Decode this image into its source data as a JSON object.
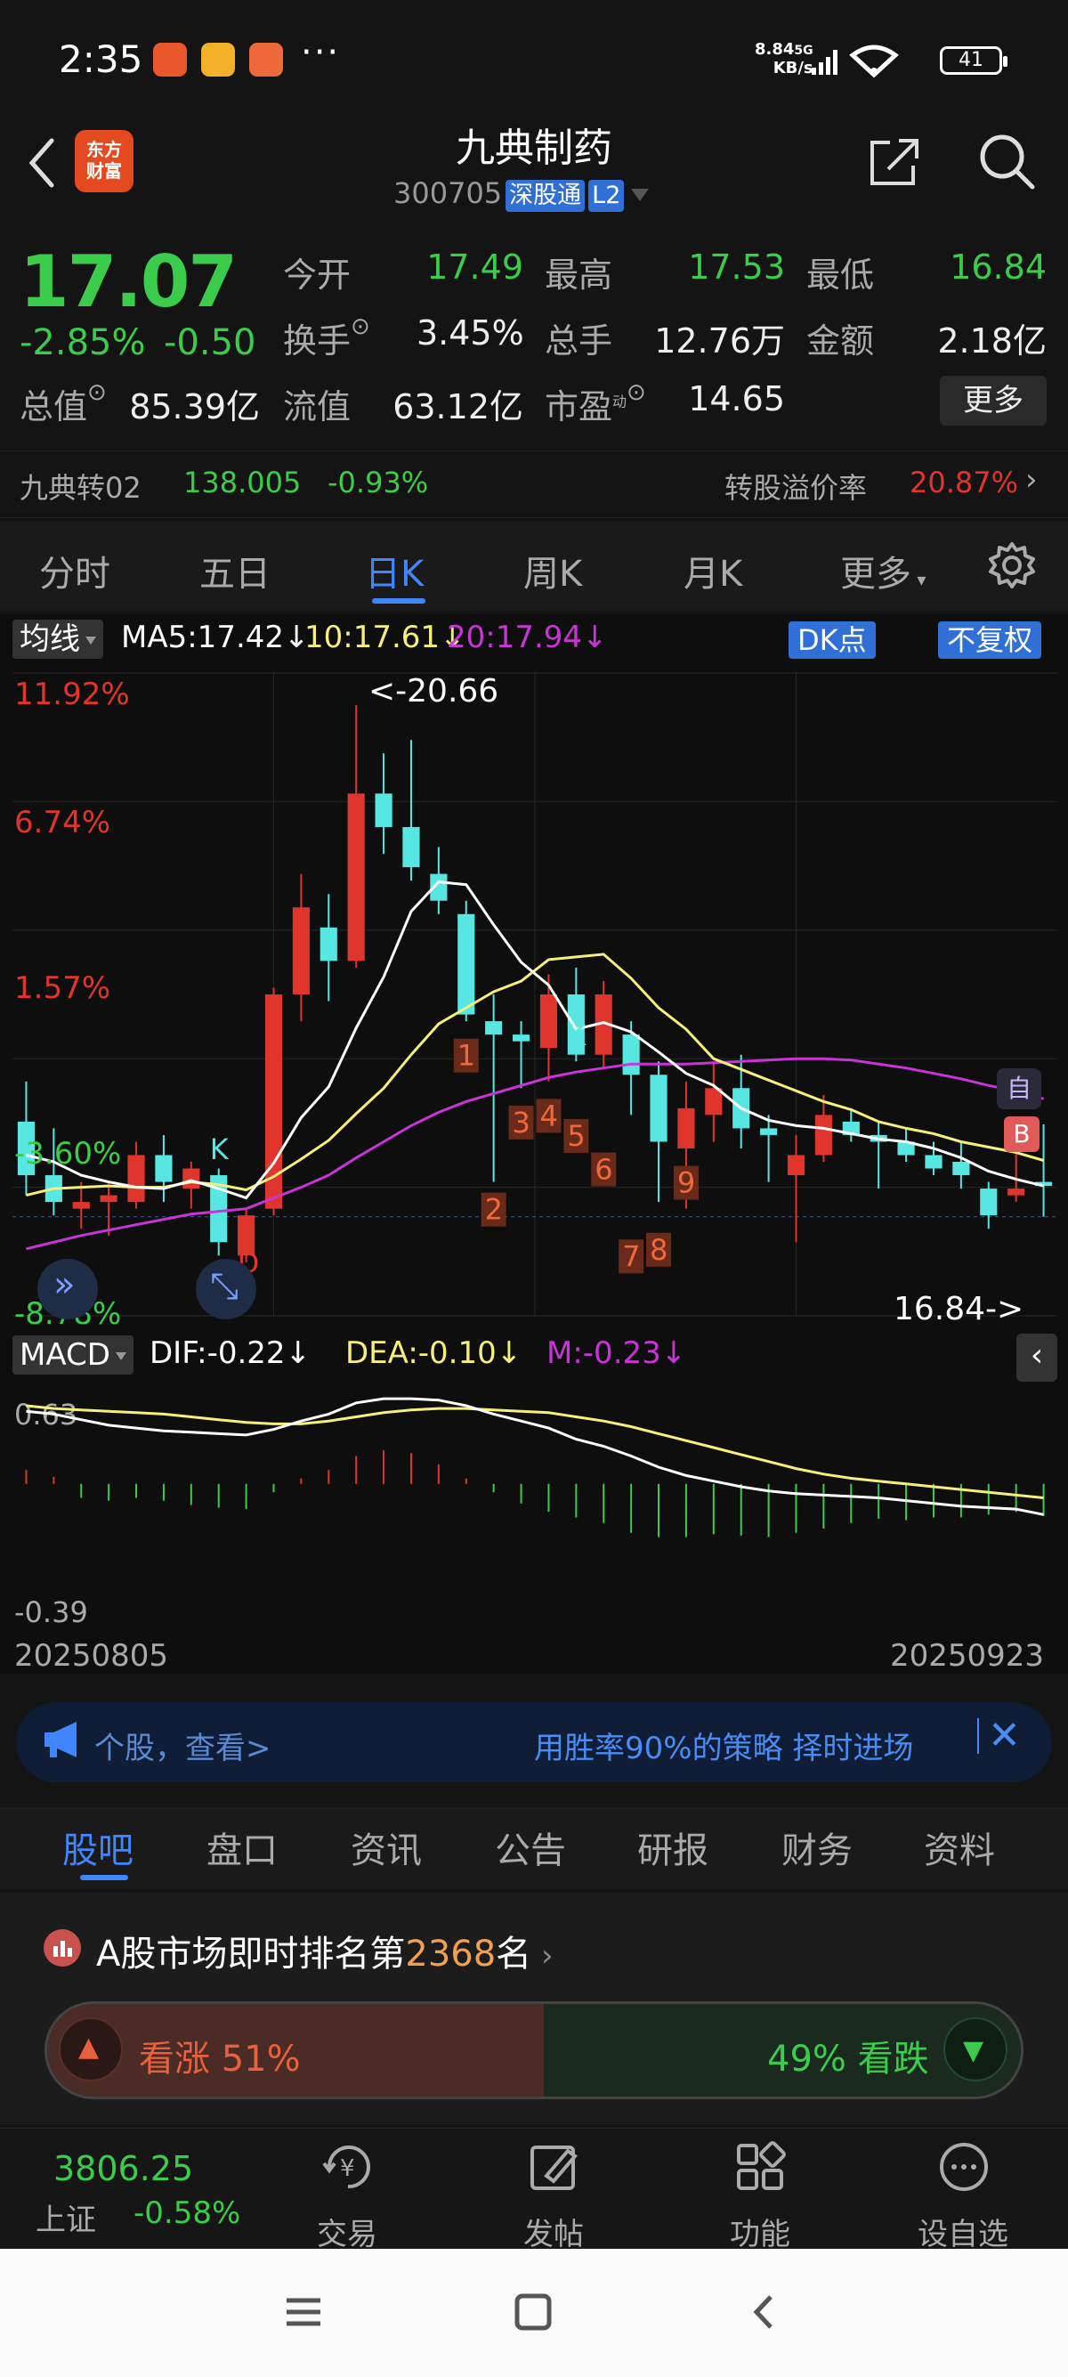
{
  "status_bar": {
    "time": "2:35",
    "more": "···",
    "net_speed_value": "8.84",
    "net_speed_unit": "KB/s",
    "network": "5G",
    "battery": "41"
  },
  "header": {
    "logo_line1": "东方",
    "logo_line2": "财富",
    "stock_name": "九典制药",
    "stock_code": "300705",
    "tag_connect": "深股通",
    "tag_level": "L2"
  },
  "quote": {
    "price": "17.07",
    "change_pct": "-2.85%",
    "change_abs": "-0.50",
    "labels": {
      "open": "今开",
      "high": "最高",
      "low": "最低",
      "turnover": "换手",
      "volume": "总手",
      "amount": "金额",
      "total_cap": "总值",
      "float_cap": "流值",
      "pe": "市盈",
      "pe_sup": "动"
    },
    "values": {
      "open": "17.49",
      "high": "17.53",
      "low": "16.84",
      "turnover": "3.45%",
      "volume": "12.76万",
      "amount": "2.18亿",
      "total_cap": "85.39亿",
      "float_cap": "63.12亿",
      "pe": "14.65"
    },
    "more_button": "更多"
  },
  "convertible": {
    "name": "九典转02",
    "price": "138.005",
    "change": "-0.93%",
    "premium_label": "转股溢价率",
    "premium_value": "20.87%"
  },
  "chart_tabs": [
    "分时",
    "五日",
    "日K",
    "周K",
    "月K",
    "更多"
  ],
  "chart_tabs_active": "日K",
  "chart_header": {
    "indicator_select": "均线",
    "ma5": "MA5:17.42",
    "ma10": "10:17.61",
    "ma20": "20:17.94",
    "dk_button": "DK点",
    "fuquan_button": "不复权"
  },
  "price_axis_labels": [
    "11.92%",
    "6.74%",
    "1.57%",
    "-3.60%",
    "-8.78%"
  ],
  "high_marker": "<-20.66",
  "low_marker": "16.84->",
  "signal_labels": [
    "K",
    "D",
    "1",
    "2",
    "3",
    "4",
    "5",
    "6",
    "7",
    "8",
    "9",
    "K"
  ],
  "badges": {
    "zi": "自",
    "b": "B"
  },
  "macd_header": {
    "indicator_select": "MACD",
    "dif": "DIF:-0.22",
    "dea": "DEA:-0.10",
    "m": "M:-0.23"
  },
  "macd_axis": [
    "0.63",
    "-0.39"
  ],
  "date_start": "20250805",
  "date_end": "20250923",
  "colors": {
    "up": "#e0352c",
    "down": "#58e6e3",
    "ma5": "#ffffff",
    "ma10": "#f6f07a",
    "ma20": "#c934d6",
    "accent": "#3f86ff",
    "green": "#3ccc4b"
  },
  "chart_data": {
    "type": "candlestick",
    "x_start": "20250805",
    "x_end": "20250923",
    "candles": [
      {
        "o": 17.55,
        "h": 17.85,
        "l": 17.0,
        "c": 17.15
      },
      {
        "o": 17.15,
        "h": 17.5,
        "l": 16.85,
        "c": 16.95
      },
      {
        "o": 16.9,
        "h": 17.1,
        "l": 16.75,
        "c": 16.95
      },
      {
        "o": 16.95,
        "h": 17.1,
        "l": 16.7,
        "c": 17.0
      },
      {
        "o": 16.95,
        "h": 17.4,
        "l": 16.9,
        "c": 17.3
      },
      {
        "o": 17.3,
        "h": 17.45,
        "l": 16.95,
        "c": 17.1
      },
      {
        "o": 17.05,
        "h": 17.25,
        "l": 16.9,
        "c": 17.2
      },
      {
        "o": 17.15,
        "h": 17.2,
        "l": 16.55,
        "c": 16.65
      },
      {
        "o": 16.55,
        "h": 16.9,
        "l": 16.5,
        "c": 16.85
      },
      {
        "o": 16.9,
        "h": 18.55,
        "l": 16.85,
        "c": 18.5
      },
      {
        "o": 18.5,
        "h": 19.4,
        "l": 18.3,
        "c": 19.15
      },
      {
        "o": 19.0,
        "h": 19.25,
        "l": 18.45,
        "c": 18.75
      },
      {
        "o": 18.75,
        "h": 20.66,
        "l": 18.7,
        "c": 20.0
      },
      {
        "o": 20.0,
        "h": 20.3,
        "l": 19.55,
        "c": 19.75
      },
      {
        "o": 19.75,
        "h": 20.4,
        "l": 19.35,
        "c": 19.45
      },
      {
        "o": 19.4,
        "h": 19.6,
        "l": 19.1,
        "c": 19.2
      },
      {
        "o": 19.1,
        "h": 19.2,
        "l": 18.3,
        "c": 18.35
      },
      {
        "o": 18.3,
        "h": 18.5,
        "l": 17.1,
        "c": 18.2
      },
      {
        "o": 18.2,
        "h": 18.3,
        "l": 17.8,
        "c": 18.15
      },
      {
        "o": 18.1,
        "h": 18.65,
        "l": 17.85,
        "c": 18.5
      },
      {
        "o": 18.5,
        "h": 18.7,
        "l": 18.0,
        "c": 18.05
      },
      {
        "o": 18.05,
        "h": 18.6,
        "l": 17.95,
        "c": 18.5
      },
      {
        "o": 18.2,
        "h": 18.3,
        "l": 17.6,
        "c": 17.9
      },
      {
        "o": 17.9,
        "h": 18.0,
        "l": 16.95,
        "c": 17.4
      },
      {
        "o": 17.35,
        "h": 17.85,
        "l": 16.9,
        "c": 17.65
      },
      {
        "o": 17.6,
        "h": 18.0,
        "l": 17.4,
        "c": 17.8
      },
      {
        "o": 17.8,
        "h": 18.05,
        "l": 17.35,
        "c": 17.5
      },
      {
        "o": 17.5,
        "h": 17.6,
        "l": 17.1,
        "c": 17.45
      },
      {
        "o": 17.15,
        "h": 17.45,
        "l": 16.65,
        "c": 17.3
      },
      {
        "o": 17.3,
        "h": 17.75,
        "l": 17.25,
        "c": 17.6
      },
      {
        "o": 17.55,
        "h": 17.65,
        "l": 17.4,
        "c": 17.45
      },
      {
        "o": 17.45,
        "h": 17.55,
        "l": 17.05,
        "c": 17.4
      },
      {
        "o": 17.4,
        "h": 17.5,
        "l": 17.25,
        "c": 17.3
      },
      {
        "o": 17.3,
        "h": 17.4,
        "l": 17.15,
        "c": 17.2
      },
      {
        "o": 17.25,
        "h": 17.4,
        "l": 17.05,
        "c": 17.15
      },
      {
        "o": 17.05,
        "h": 17.1,
        "l": 16.75,
        "c": 16.85
      },
      {
        "o": 17.0,
        "h": 17.55,
        "l": 16.95,
        "c": 17.05
      },
      {
        "o": 17.1,
        "h": 17.53,
        "l": 16.84,
        "c": 17.07
      }
    ],
    "ma5": [
      17.3,
      17.25,
      17.15,
      17.1,
      17.06,
      17.05,
      17.11,
      17.05,
      16.98,
      17.24,
      17.58,
      17.81,
      18.25,
      18.63,
      19.12,
      19.34,
      19.32,
      19.02,
      18.74,
      18.57,
      18.24,
      18.29,
      18.22,
      18.07,
      17.91,
      17.82,
      17.65,
      17.56,
      17.52,
      17.5,
      17.46,
      17.42,
      17.4,
      17.35,
      17.28,
      17.18,
      17.12,
      17.07
    ],
    "ma10": [
      17.0,
      17.05,
      17.06,
      17.07,
      17.06,
      17.06,
      17.1,
      17.08,
      17.04,
      17.14,
      17.27,
      17.41,
      17.61,
      17.8,
      18.05,
      18.28,
      18.4,
      18.52,
      18.6,
      18.76,
      18.78,
      18.8,
      18.62,
      18.4,
      18.24,
      18.02,
      17.94,
      17.86,
      17.78,
      17.7,
      17.64,
      17.55,
      17.5,
      17.46,
      17.4,
      17.36,
      17.32,
      17.26
    ],
    "ma20": [
      16.6,
      16.65,
      16.7,
      16.74,
      16.78,
      16.82,
      16.86,
      16.88,
      16.9,
      16.98,
      17.06,
      17.15,
      17.28,
      17.4,
      17.52,
      17.62,
      17.7,
      17.76,
      17.82,
      17.88,
      17.92,
      17.95,
      17.98,
      17.98,
      17.98,
      17.99,
      18.0,
      18.01,
      18.02,
      18.02,
      18.01,
      17.98,
      17.95,
      17.91,
      17.87,
      17.82,
      17.78,
      17.72
    ],
    "price_range": [
      16.1,
      20.9
    ],
    "macd": {
      "dif": [
        0.52,
        0.5,
        0.46,
        0.42,
        0.4,
        0.38,
        0.37,
        0.36,
        0.35,
        0.39,
        0.45,
        0.5,
        0.58,
        0.61,
        0.61,
        0.6,
        0.56,
        0.5,
        0.45,
        0.4,
        0.32,
        0.27,
        0.2,
        0.12,
        0.06,
        0.02,
        -0.02,
        -0.05,
        -0.07,
        -0.08,
        -0.09,
        -0.1,
        -0.12,
        -0.14,
        -0.16,
        -0.17,
        -0.18,
        -0.22
      ],
      "dea": [
        0.56,
        0.54,
        0.53,
        0.52,
        0.51,
        0.5,
        0.48,
        0.46,
        0.44,
        0.43,
        0.43,
        0.45,
        0.48,
        0.51,
        0.53,
        0.54,
        0.54,
        0.53,
        0.52,
        0.51,
        0.48,
        0.45,
        0.41,
        0.36,
        0.31,
        0.26,
        0.21,
        0.16,
        0.11,
        0.07,
        0.04,
        0.02,
        0.0,
        -0.02,
        -0.04,
        -0.06,
        -0.08,
        -0.1
      ],
      "m": [
        0.1,
        0.05,
        -0.1,
        -0.12,
        -0.1,
        -0.12,
        -0.15,
        -0.17,
        -0.18,
        -0.06,
        0.04,
        0.1,
        0.2,
        0.24,
        0.22,
        0.14,
        0.04,
        -0.06,
        -0.14,
        -0.2,
        -0.24,
        -0.28,
        -0.35,
        -0.38,
        -0.38,
        -0.36,
        -0.37,
        -0.38,
        -0.35,
        -0.32,
        -0.28,
        -0.25,
        -0.26,
        -0.24,
        -0.24,
        -0.22,
        -0.2,
        -0.23
      ],
      "range": [
        -0.39,
        0.63
      ]
    }
  },
  "ad_banner": {
    "left": "个股，查看>",
    "right": "用胜率90%的策略 择时进场"
  },
  "section_tabs": [
    "股吧",
    "盘口",
    "资讯",
    "公告",
    "研报",
    "财务",
    "资料"
  ],
  "section_tabs_active": "股吧",
  "ranking": {
    "prefix": "A股市场即时排名第",
    "rank": "2368",
    "suffix": "名"
  },
  "vote": {
    "up_label": "看涨 51%",
    "down_label": "49% 看跌",
    "up_pct": 51
  },
  "bottom_nav": {
    "index_value": "3806.25",
    "index_name": "上证",
    "index_change": "-0.58%",
    "items": [
      "交易",
      "发帖",
      "功能",
      "设自选"
    ]
  }
}
